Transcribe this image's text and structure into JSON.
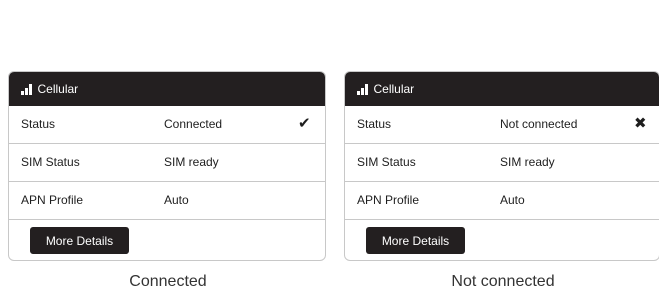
{
  "panels": [
    {
      "title": "Cellular",
      "icon": "signal-bars-icon",
      "rows": [
        {
          "label": "Status",
          "value": "Connected",
          "status_icon": "checkmark-icon",
          "status_glyph": "✔"
        },
        {
          "label": "SIM Status",
          "value": "SIM ready"
        },
        {
          "label": "APN Profile",
          "value": "Auto"
        }
      ],
      "button_label": "More Details",
      "caption": "Connected"
    },
    {
      "title": "Cellular",
      "icon": "signal-bars-icon",
      "rows": [
        {
          "label": "Status",
          "value": "Not connected",
          "status_icon": "cross-icon",
          "status_glyph": "✖"
        },
        {
          "label": "SIM Status",
          "value": "SIM ready"
        },
        {
          "label": "APN Profile",
          "value": "Auto"
        }
      ],
      "button_label": "More Details",
      "caption": "Not connected"
    }
  ],
  "colors": {
    "header_bg": "#231f20",
    "header_text": "#ffffff",
    "border": "#c8c8c8",
    "button_bg": "#231f20"
  }
}
